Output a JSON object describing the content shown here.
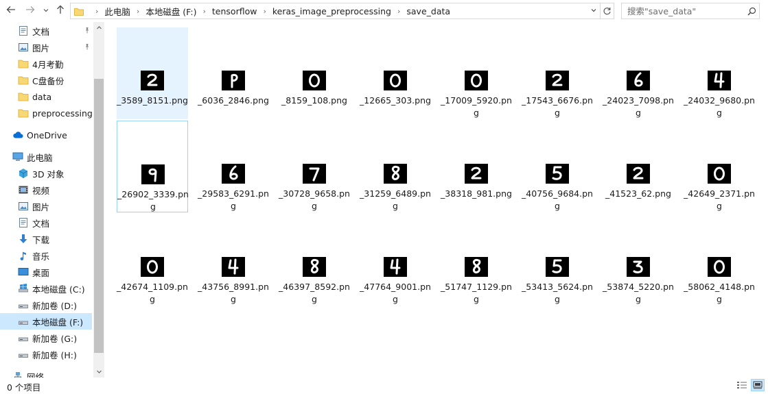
{
  "colors": {
    "accent": "#0078d7",
    "selection_bg": "#cce8ff",
    "hover_bg": "#e5f3ff",
    "focus_border": "#99d1ff",
    "folder": "#f8d775"
  },
  "toolbar": {
    "back_icon": "arrow-left-icon",
    "forward_icon": "arrow-right-icon",
    "history_icon": "chevron-down-icon",
    "up_icon": "arrow-up-icon"
  },
  "address": {
    "crumbs": [
      "此电脑",
      "本地磁盘 (F:)",
      "tensorflow",
      "keras_image_preprocessing",
      "save_data"
    ]
  },
  "search": {
    "placeholder": "搜索\"save_data\""
  },
  "sidebar": {
    "items": [
      {
        "label": "文档",
        "icon": "documents-icon",
        "pinned": true
      },
      {
        "label": "图片",
        "icon": "pictures-icon",
        "pinned": true
      },
      {
        "label": "4月考勤",
        "icon": "folder-icon"
      },
      {
        "label": "C盘备份",
        "icon": "folder-icon"
      },
      {
        "label": "data",
        "icon": "folder-icon"
      },
      {
        "label": "preprocessing",
        "icon": "folder-icon"
      },
      {
        "label": "OneDrive",
        "icon": "cloud-icon"
      },
      {
        "label": "此电脑",
        "icon": "computer-icon"
      },
      {
        "label": "3D 对象",
        "icon": "3d-objects-icon"
      },
      {
        "label": "视频",
        "icon": "videos-icon"
      },
      {
        "label": "图片",
        "icon": "pictures-icon"
      },
      {
        "label": "文档",
        "icon": "documents-icon"
      },
      {
        "label": "下载",
        "icon": "download-icon"
      },
      {
        "label": "音乐",
        "icon": "music-icon"
      },
      {
        "label": "桌面",
        "icon": "desktop-icon"
      },
      {
        "label": "本地磁盘 (C:)",
        "icon": "windows-drive-icon"
      },
      {
        "label": "新加卷 (D:)",
        "icon": "drive-icon"
      },
      {
        "label": "本地磁盘 (F:)",
        "icon": "drive-icon",
        "selected": true
      },
      {
        "label": "新加卷 (G:)",
        "icon": "drive-icon"
      },
      {
        "label": "新加卷 (H:)",
        "icon": "drive-icon"
      },
      {
        "label": "网络",
        "icon": "network-icon"
      }
    ]
  },
  "files": [
    {
      "name": "_3589_8151.png",
      "digit": "2"
    },
    {
      "name": "_6036_2846.png",
      "digit": "P"
    },
    {
      "name": "_8159_108.png",
      "digit": "0"
    },
    {
      "name": "_12665_303.png",
      "digit": "0"
    },
    {
      "name": "_17009_5920.png",
      "digit": "0"
    },
    {
      "name": "_17543_6676.png",
      "digit": "2"
    },
    {
      "name": "_24023_7098.png",
      "digit": "6"
    },
    {
      "name": "_24032_9680.png",
      "digit": "4"
    },
    {
      "name": "_26902_3339.png",
      "digit": "9"
    },
    {
      "name": "_29583_6291.png",
      "digit": "6"
    },
    {
      "name": "_30728_9658.png",
      "digit": "7"
    },
    {
      "name": "_31259_6489.png",
      "digit": "8"
    },
    {
      "name": "_38318_981.png",
      "digit": "2"
    },
    {
      "name": "_40756_9684.png",
      "digit": "5"
    },
    {
      "name": "_41523_62.png",
      "digit": "2"
    },
    {
      "name": "_42649_2371.png",
      "digit": "0"
    },
    {
      "name": "_42674_1109.png",
      "digit": "0"
    },
    {
      "name": "_43756_8991.png",
      "digit": "4"
    },
    {
      "name": "_46397_8592.png",
      "digit": "8"
    },
    {
      "name": "_47764_9001.png",
      "digit": "4"
    },
    {
      "name": "_51747_1129.png",
      "digit": "8"
    },
    {
      "name": "_53413_5624.png",
      "digit": "5"
    },
    {
      "name": "_53874_5220.png",
      "digit": "3"
    },
    {
      "name": "_58062_4148.png",
      "digit": "0"
    }
  ],
  "status": {
    "item_count": "0 个项目"
  },
  "view": {
    "details_icon": "details-view-icon",
    "large_icons_icon": "large-icons-view-icon"
  }
}
